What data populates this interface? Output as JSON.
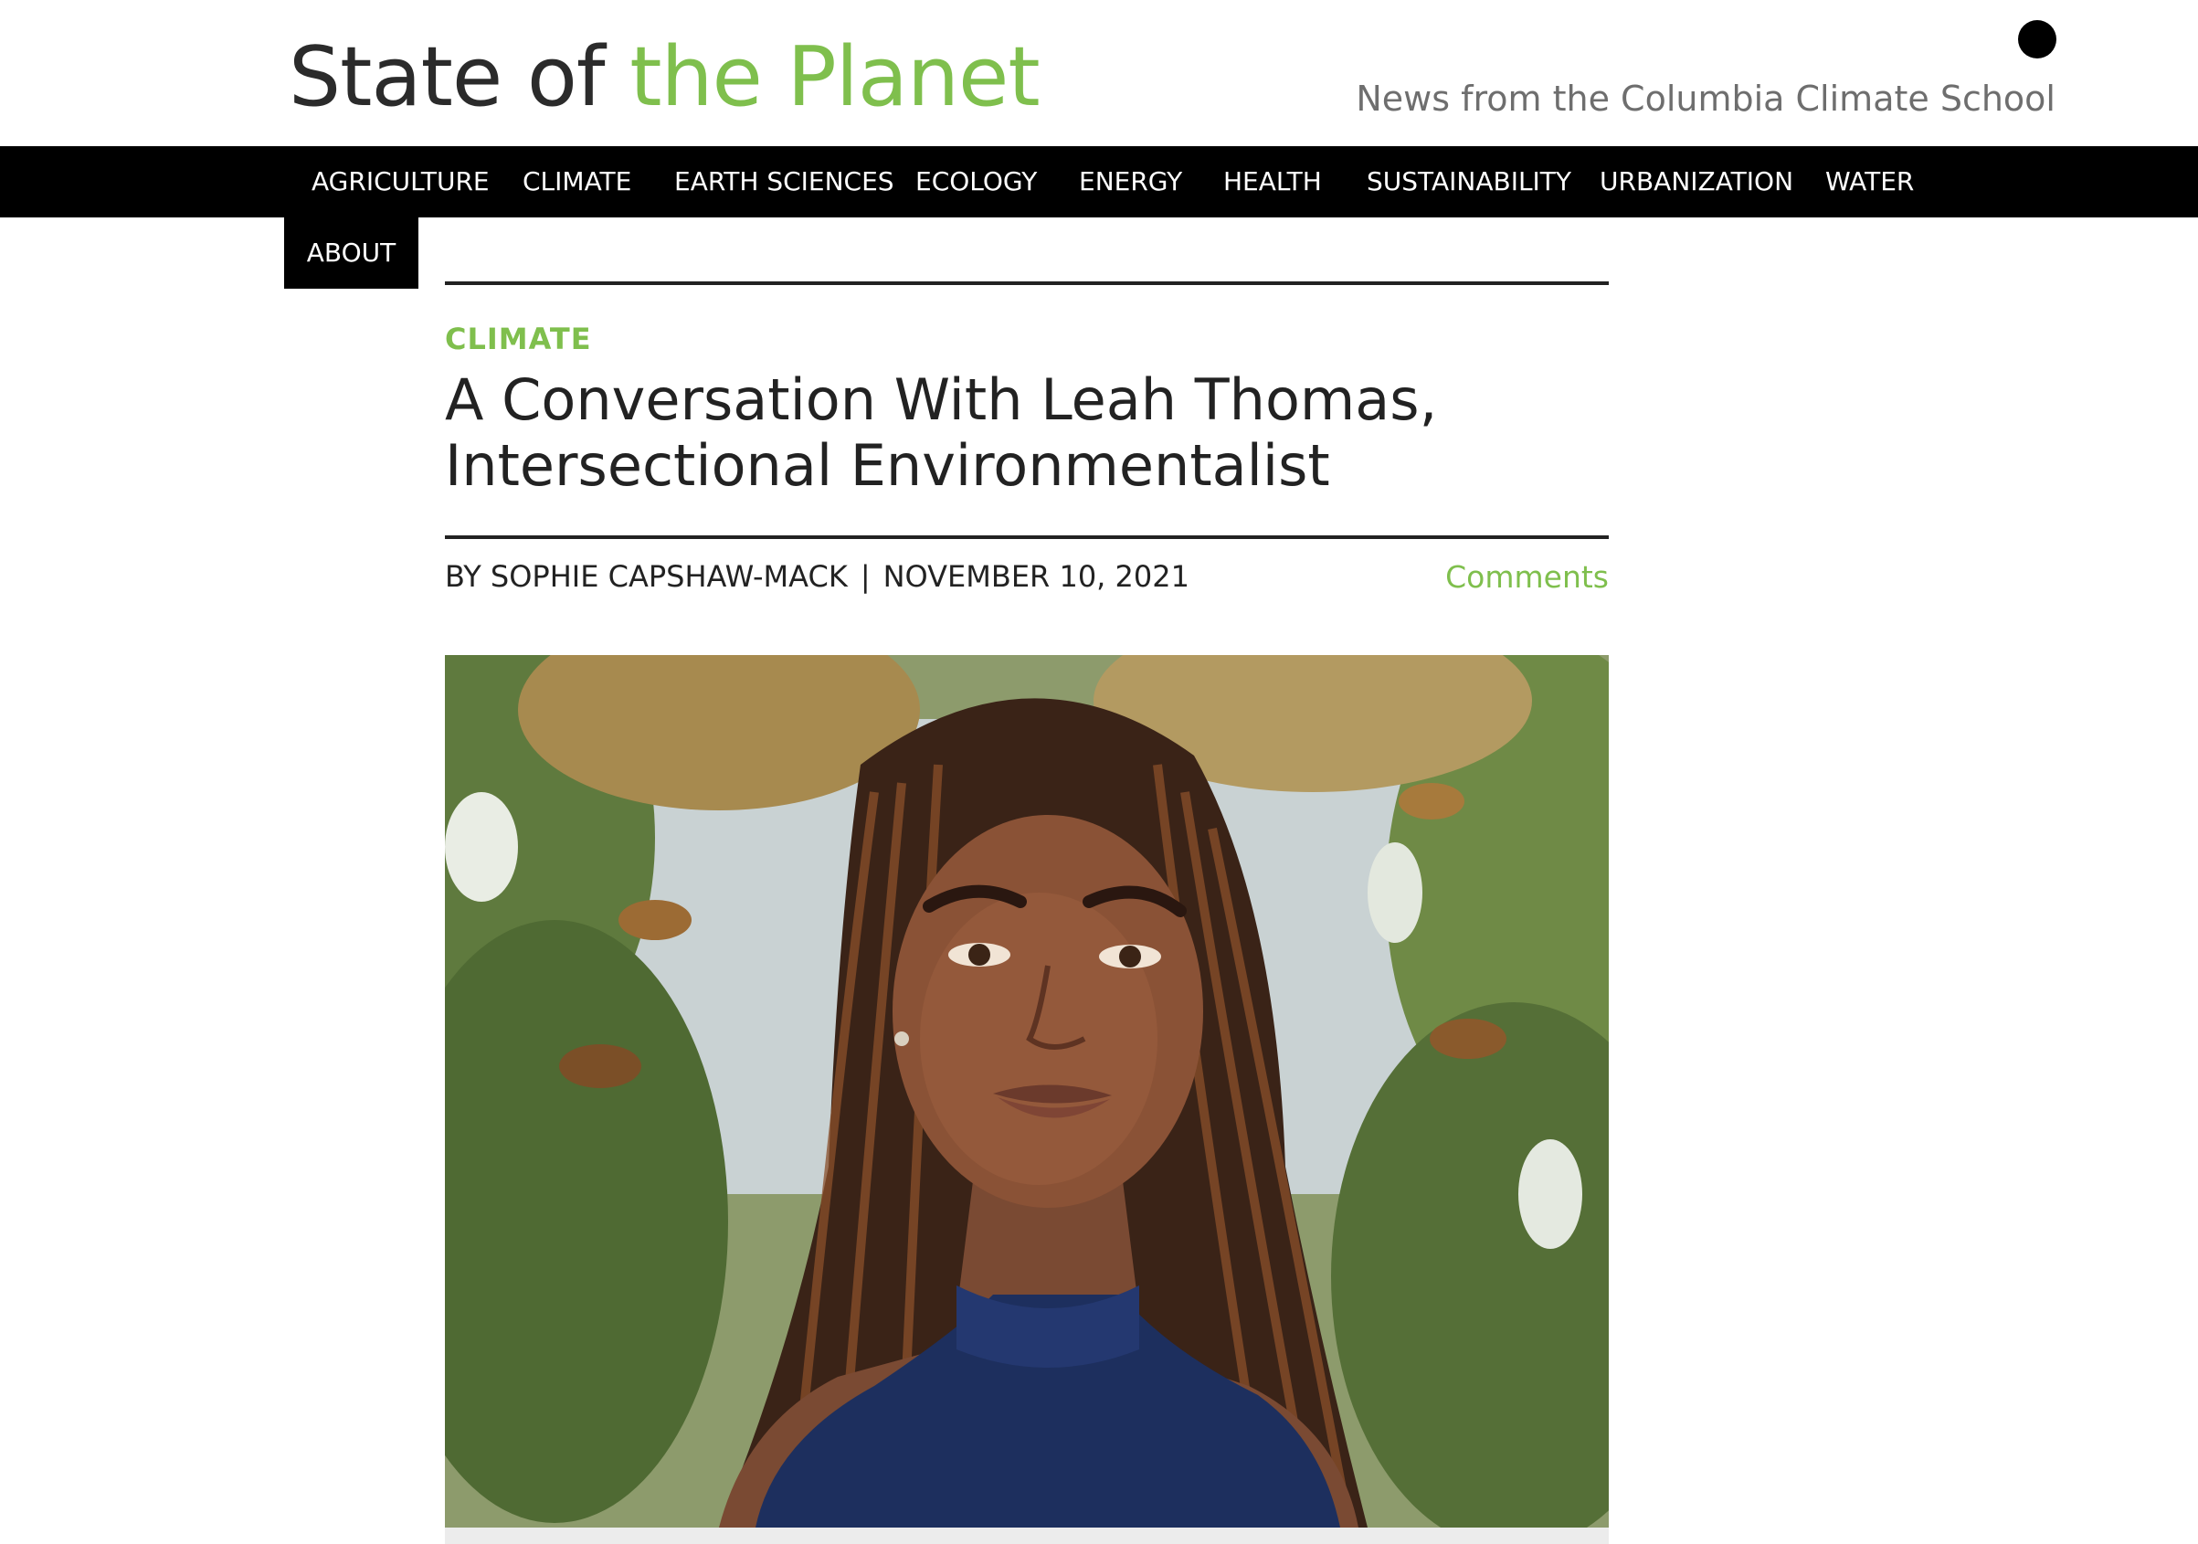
{
  "header": {
    "logo_part1": "State of ",
    "logo_part2": "the Planet",
    "tagline": "News from the Columbia Climate School"
  },
  "nav": {
    "items": [
      {
        "label": "AGRICULTURE"
      },
      {
        "label": "CLIMATE"
      },
      {
        "label": "EARTH SCIENCES"
      },
      {
        "label": "ECOLOGY"
      },
      {
        "label": "ENERGY"
      },
      {
        "label": "HEALTH"
      },
      {
        "label": "SUSTAINABILITY"
      },
      {
        "label": "URBANIZATION"
      },
      {
        "label": "WATER"
      }
    ],
    "about": "ABOUT"
  },
  "article": {
    "category": "CLIMATE",
    "title_line1": "A Conversation With Leah Thomas,",
    "title_line2": "Intersectional Environmentalist",
    "author": "BY SOPHIE CAPSHAW-MACK",
    "separator": "|",
    "date": "NOVEMBER 10, 2021",
    "comments": "Comments"
  },
  "colors": {
    "brand_green": "#7fbf4d",
    "nav_bg": "#000000",
    "text": "#222222"
  }
}
